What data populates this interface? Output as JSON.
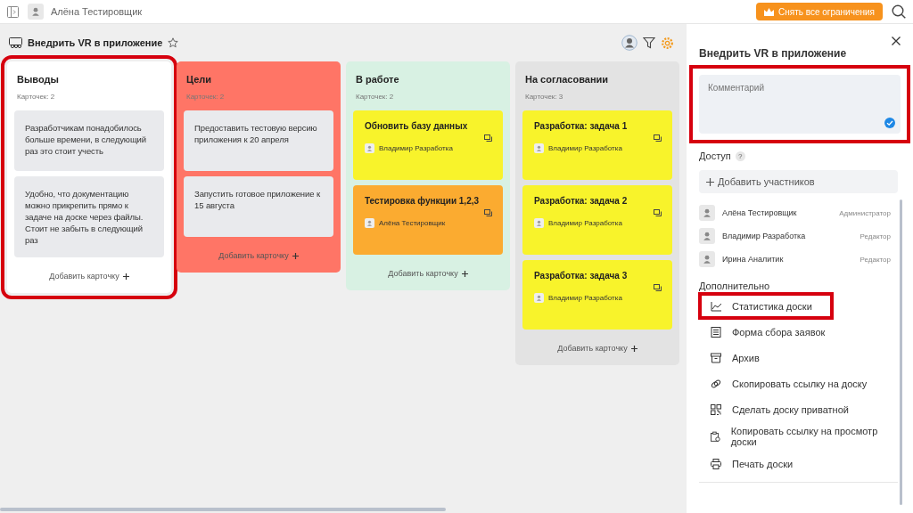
{
  "topbar": {
    "user": "Алёна Тестировщик",
    "upgrade_button": "Снять все ограничения"
  },
  "board": {
    "title": "Внедрить VR в приложение",
    "columns": [
      {
        "title": "Выводы",
        "count": "Карточек: 2",
        "color": "#ffffff",
        "highlighted": true,
        "add_label": "Добавить карточку",
        "cards": [
          {
            "kind": "note",
            "text": "Разработчикам понадобилось больше времени, в следующий раз это стоит учесть"
          },
          {
            "kind": "note",
            "text": "Удобно, что документацию можно прикрепить прямо к задаче на доске через файлы. Стоит не забыть в следующий раз"
          }
        ]
      },
      {
        "title": "Цели",
        "count": "Карточек: 2",
        "color": "#ff7566",
        "highlighted": false,
        "add_label": "Добавить карточку",
        "cards": [
          {
            "kind": "note",
            "text": "Предоставить тестовую версию приложения к 20 апреля"
          },
          {
            "kind": "note",
            "text": "Запустить готовое приложение к 15 августа"
          }
        ]
      },
      {
        "title": "В работе",
        "count": "Карточек: 2",
        "color": "#d8f1e3",
        "highlighted": false,
        "add_label": "Добавить карточку",
        "cards": [
          {
            "kind": "task",
            "text": "Обновить базу данных",
            "assignee": "Владимир Разработка",
            "color": "#f8f32b"
          },
          {
            "kind": "task",
            "text": "Тестировка функции 1,2,3",
            "assignee": "Алёна Тестировщик",
            "color": "#fbab30"
          }
        ]
      },
      {
        "title": "На согласовании",
        "count": "Карточек: 3",
        "color": "#e3e3e3",
        "highlighted": false,
        "add_label": "Добавить карточку",
        "cards": [
          {
            "kind": "task",
            "text": "Разработка: задача 1",
            "assignee": "Владимир Разработка",
            "color": "#f8f32b"
          },
          {
            "kind": "task",
            "text": "Разработка: задача 2",
            "assignee": "Владимир Разработка",
            "color": "#f8f32b"
          },
          {
            "kind": "task",
            "text": "Разработка: задача 3",
            "assignee": "Владимир Разработка",
            "color": "#f8f32b"
          }
        ]
      }
    ]
  },
  "panel": {
    "title": "Внедрить VR в приложение",
    "comment": {
      "placeholder": "Комментарий",
      "highlighted": true
    },
    "access": {
      "title": "Доступ",
      "help": "?",
      "add_button": "Добавить участников",
      "members": [
        {
          "name": "Алёна Тестировщик",
          "role": "Администратор"
        },
        {
          "name": "Владимир Разработка",
          "role": "Редактор"
        },
        {
          "name": "Ирина Аналитик",
          "role": "Редактор"
        }
      ]
    },
    "extra": {
      "title": "Дополнительно",
      "items": [
        {
          "label": "Статистика доски",
          "highlighted": true
        },
        {
          "label": "Форма сбора заявок",
          "highlighted": false
        },
        {
          "label": "Архив",
          "highlighted": false
        },
        {
          "label": "Скопировать ссылку на доску",
          "highlighted": false
        },
        {
          "label": "Сделать доску приватной",
          "highlighted": false
        },
        {
          "label": "Копировать ссылку на просмотр доски",
          "highlighted": false
        },
        {
          "label": "Печать доски",
          "highlighted": false
        }
      ]
    }
  }
}
